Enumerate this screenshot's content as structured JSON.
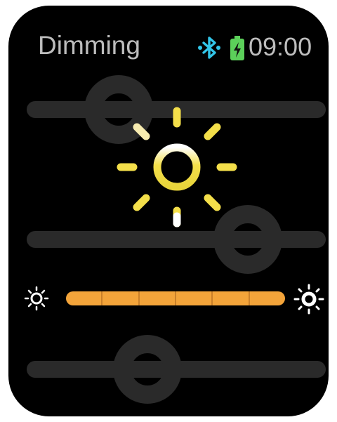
{
  "header": {
    "title": "Dimming",
    "time": "09:00",
    "bluetooth_icon": "bluetooth-icon",
    "battery_icon": "battery-charging-icon"
  },
  "brightness": {
    "level_fraction": 1.0,
    "segments": 6,
    "fill_color": "#f3a43a",
    "decrease_icon": "sun-small-icon",
    "increase_icon": "sun-large-icon"
  },
  "colors": {
    "accent": "#f3a43a",
    "sun": "#f4df4a",
    "bluetooth": "#32c5e8",
    "battery": "#5cd05a"
  }
}
